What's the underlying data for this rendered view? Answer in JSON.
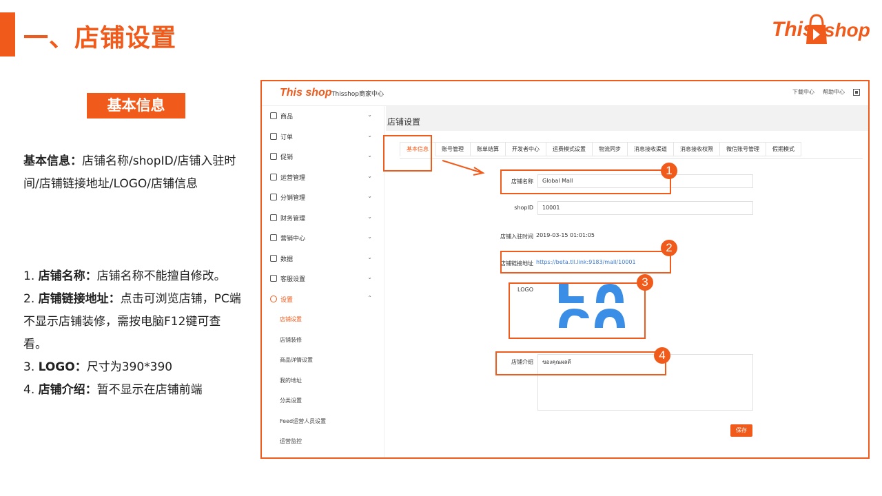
{
  "header": {
    "title": "一、店铺设置",
    "brand_part1": "This",
    "brand_part2": "shop"
  },
  "left": {
    "badge": "基本信息",
    "desc_bold": "基本信息：",
    "desc_text": "店铺名称/shopID/店铺入驻时间/店铺链接地址/LOGO/店铺信息",
    "notes": [
      {
        "num": "1. ",
        "bold": "店铺名称：",
        "text": "店铺名称不能擅自修改。"
      },
      {
        "num": "2. ",
        "bold": "店铺链接地址：",
        "text": "点击可浏览店铺，PC端不显示店铺装修，需按电脑F12键可查看。"
      },
      {
        "num": "3. ",
        "bold": "LOGO：",
        "text": "尺寸为390*390"
      },
      {
        "num": "4. ",
        "bold": "店铺介绍：",
        "text": "暂不显示在店铺前端"
      }
    ]
  },
  "screenshot": {
    "topbar": {
      "logo1": "This",
      "logo2": "shop",
      "center_name": "Thisshop商家中心",
      "links": [
        "下载中心",
        "帮助中心"
      ]
    },
    "sidebar": {
      "items": [
        {
          "label": "商品",
          "chev": "⌄"
        },
        {
          "label": "订单",
          "chev": "⌄"
        },
        {
          "label": "促销",
          "chev": "⌄"
        },
        {
          "label": "运营管理",
          "chev": "⌄"
        },
        {
          "label": "分销管理",
          "chev": "⌄"
        },
        {
          "label": "财务管理",
          "chev": "⌄"
        },
        {
          "label": "营销中心",
          "chev": "⌄"
        },
        {
          "label": "数据",
          "chev": "⌄"
        },
        {
          "label": "客服设置",
          "chev": "⌄"
        },
        {
          "label": "设置",
          "chev": "⌃"
        }
      ],
      "sub_items": [
        "店铺设置",
        "店铺装修",
        "商品详情设置",
        "我的地址",
        "分类设置",
        "Feed运营人员设置",
        "运营监控"
      ]
    },
    "main": {
      "crumb": "店铺设置",
      "tabs": [
        "基本信息",
        "账号管理",
        "账单结算",
        "开发者中心",
        "运费模式设置",
        "物流同步",
        "消息接收渠道",
        "消息接收权限",
        "微信账号管理",
        "假期模式"
      ],
      "form": {
        "name_label": "店铺名称",
        "name_value": "Global Mall",
        "shopid_label": "shopID",
        "shopid_value": "10001",
        "join_label": "店铺入驻时间",
        "join_value": "2019-03-15 01:01:05",
        "link_label": "店铺链接地址",
        "link_value": "https://beta.tll.link:9183/mall/10001",
        "logo_label": "LOGO",
        "intro_label": "店铺介绍",
        "intro_value": "ของคุณผลดี",
        "save": "保存"
      }
    },
    "markers": [
      "1",
      "2",
      "3",
      "4"
    ]
  }
}
